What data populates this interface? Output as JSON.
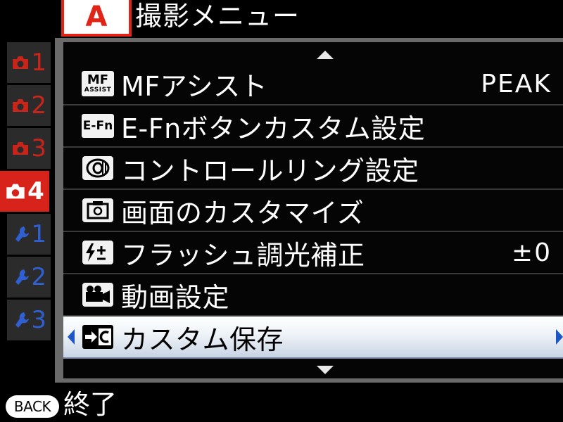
{
  "header": {
    "mode_badge": "A",
    "title": "撮影メニュー"
  },
  "side_tabs": [
    {
      "icon": "camera-icon",
      "number": "1",
      "color": "#c9241a",
      "active": false
    },
    {
      "icon": "camera-icon",
      "number": "2",
      "color": "#c9241a",
      "active": false
    },
    {
      "icon": "camera-icon",
      "number": "3",
      "color": "#c9241a",
      "active": false
    },
    {
      "icon": "camera-icon",
      "number": "4",
      "color": "#ffffff",
      "active": true
    },
    {
      "icon": "wrench-icon",
      "number": "1",
      "color": "#2f5fd0",
      "active": false
    },
    {
      "icon": "wrench-icon",
      "number": "2",
      "color": "#2f5fd0",
      "active": false
    },
    {
      "icon": "wrench-icon",
      "number": "3",
      "color": "#2f5fd0",
      "active": false
    }
  ],
  "menu": {
    "items": [
      {
        "icon": "mf-assist-icon",
        "icon_text_top": "MF",
        "icon_text_bottom": "ASSIST",
        "label": "MFアシスト",
        "value": "PEAK",
        "selected": false
      },
      {
        "icon": "e-fn-icon",
        "icon_text": "E-Fn",
        "label": "E-Fnボタンカスタム設定",
        "value": "",
        "selected": false
      },
      {
        "icon": "control-ring-icon",
        "label": "コントロールリング設定",
        "value": "",
        "selected": false
      },
      {
        "icon": "display-custom-icon",
        "label": "画面のカスタマイズ",
        "value": "",
        "selected": false
      },
      {
        "icon": "flash-compensation-icon",
        "label": "フラッシュ調光補正",
        "value": "±0",
        "selected": false
      },
      {
        "icon": "movie-camera-icon",
        "label": "動画設定",
        "value": "",
        "selected": false
      },
      {
        "icon": "custom-save-icon",
        "label": "カスタム保存",
        "value": "",
        "selected": true
      }
    ]
  },
  "footer": {
    "back_button": "BACK",
    "back_action": "終了"
  },
  "colors": {
    "accent_red": "#e02418",
    "accent_blue": "#1e56c8",
    "panel_border": "#6a6a6a"
  }
}
